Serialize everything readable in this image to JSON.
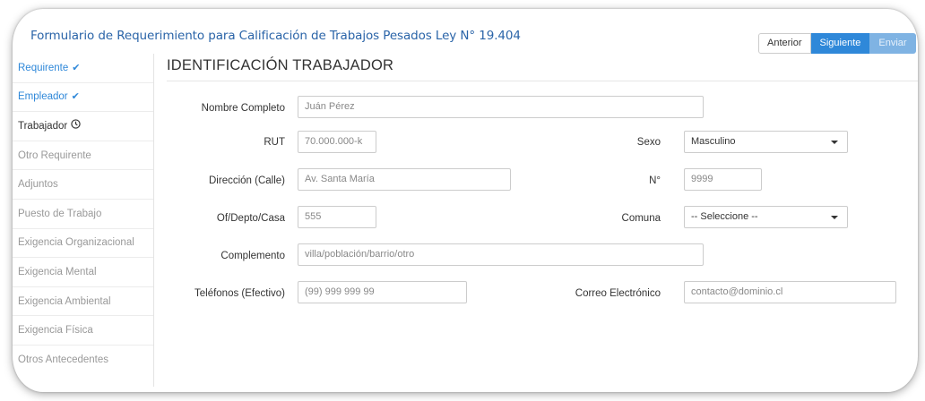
{
  "header": {
    "title": "Formulario de Requerimiento para Calificación de Trabajos Pesados Ley N° 19.404",
    "btn_anterior": "Anterior",
    "btn_siguiente": "Siguiente",
    "btn_enviar": "Enviar"
  },
  "sidebar": {
    "items": [
      {
        "label": "Requirente",
        "state": "done",
        "icon": "check-icon"
      },
      {
        "label": "Empleador",
        "state": "done",
        "icon": "check-icon"
      },
      {
        "label": "Trabajador",
        "state": "active",
        "icon": "clock-icon"
      },
      {
        "label": "Otro Requirente",
        "state": "pending"
      },
      {
        "label": "Adjuntos",
        "state": "pending"
      },
      {
        "label": "Puesto de Trabajo",
        "state": "pending"
      },
      {
        "label": "Exigencia Organizacional",
        "state": "pending"
      },
      {
        "label": "Exigencia Mental",
        "state": "pending"
      },
      {
        "label": "Exigencia Ambiental",
        "state": "pending"
      },
      {
        "label": "Exigencia Física",
        "state": "pending"
      },
      {
        "label": "Otros Antecedentes",
        "state": "pending"
      }
    ],
    "check_glyph": "✔",
    "clock_glyph": "⏲"
  },
  "form": {
    "section_title": "IDENTIFICACIÓN TRABAJADOR",
    "nombre": {
      "label": "Nombre Completo",
      "placeholder": "Juán Pérez"
    },
    "rut": {
      "label": "RUT",
      "placeholder": "70.000.000-k"
    },
    "sexo": {
      "label": "Sexo",
      "value": "Masculino"
    },
    "direccion": {
      "label": "Dirección (Calle)",
      "placeholder": "Av. Santa María"
    },
    "numero": {
      "label": "N°",
      "placeholder": "9999"
    },
    "ofdepto": {
      "label": "Of/Depto/Casa",
      "placeholder": "555"
    },
    "comuna": {
      "label": "Comuna",
      "value": "-- Seleccione --"
    },
    "complemento": {
      "label": "Complemento",
      "placeholder": "villa/población/barrio/otro"
    },
    "telefonos": {
      "label": "Teléfonos (Efectivo)",
      "placeholder": "(99) 999 999 99"
    },
    "correo": {
      "label": "Correo Electrónico",
      "placeholder": "contacto@dominio.cl"
    }
  },
  "colors": {
    "accent": "#2f88d9",
    "title": "#2a64a8"
  }
}
